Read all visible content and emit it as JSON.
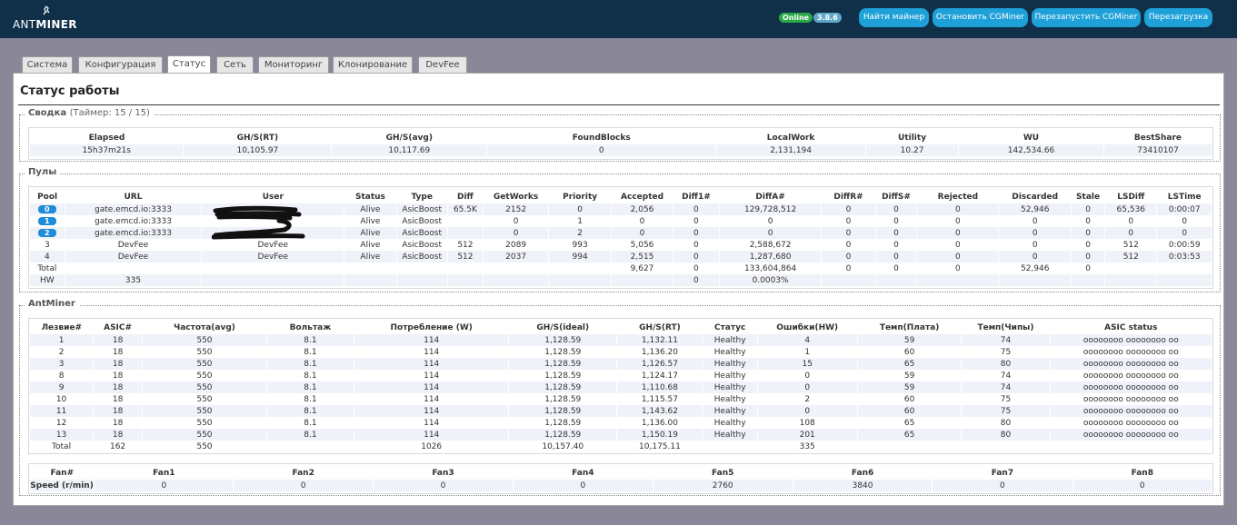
{
  "header": {
    "logo_prefix": "ANT",
    "logo_suffix": "MINER",
    "status_badge": "Online",
    "version_badge": "3.8.6",
    "buttons": [
      "Найти майнер",
      "Остановить CGMiner",
      "Перезапустить CGMiner",
      "Перезагрузка"
    ]
  },
  "tabs": [
    {
      "label": "Система",
      "active": false
    },
    {
      "label": "Конфигурация",
      "active": false
    },
    {
      "label": "Статус",
      "active": true
    },
    {
      "label": "Сеть",
      "active": false
    },
    {
      "label": "Мониторинг",
      "active": false
    },
    {
      "label": "Клонирование",
      "active": false
    },
    {
      "label": "DevFee",
      "active": false
    }
  ],
  "page_title": "Статус работы",
  "summary": {
    "legend": "Сводка",
    "timer": "(Таймер: 15 / 15)",
    "headers": [
      "Elapsed",
      "GH/S(RT)",
      "GH/S(avg)",
      "FoundBlocks",
      "LocalWork",
      "Utility",
      "WU",
      "BestShare"
    ],
    "values": [
      "15h37m21s",
      "10,105.97",
      "10,117.69",
      "0",
      "2,131,194",
      "10.27",
      "142,534.66",
      "73410107"
    ]
  },
  "pools": {
    "legend": "Пулы",
    "headers": [
      "Pool",
      "URL",
      "User",
      "Status",
      "Type",
      "Diff",
      "GetWorks",
      "Priority",
      "Accepted",
      "Diff1#",
      "DiffA#",
      "DiffR#",
      "DiffS#",
      "Rejected",
      "Discarded",
      "Stale",
      "LSDiff",
      "LSTime"
    ],
    "rows": [
      [
        "0",
        "gate.emcd.io:3333",
        "",
        "Alive",
        "AsicBoost",
        "65.5K",
        "2152",
        "0",
        "2,056",
        "0",
        "129,728,512",
        "0",
        "0",
        "0",
        "52,946",
        "0",
        "65,536",
        "0:00:07"
      ],
      [
        "1",
        "gate.emcd.io:3333",
        "",
        "Alive",
        "AsicBoost",
        "",
        "0",
        "1",
        "0",
        "0",
        "0",
        "0",
        "0",
        "0",
        "0",
        "0",
        "0",
        "0"
      ],
      [
        "2",
        "gate.emcd.io:3333",
        "",
        "Alive",
        "AsicBoost",
        "",
        "0",
        "2",
        "0",
        "0",
        "0",
        "0",
        "0",
        "0",
        "0",
        "0",
        "0",
        "0"
      ],
      [
        "3",
        "DevFee",
        "DevFee",
        "Alive",
        "AsicBoost",
        "512",
        "2089",
        "993",
        "5,056",
        "0",
        "2,588,672",
        "0",
        "0",
        "0",
        "0",
        "0",
        "512",
        "0:00:59"
      ],
      [
        "4",
        "DevFee",
        "DevFee",
        "Alive",
        "AsicBoost",
        "512",
        "2037",
        "994",
        "2,515",
        "0",
        "1,287,680",
        "0",
        "0",
        "0",
        "0",
        "0",
        "512",
        "0:03:53"
      ],
      [
        "Total",
        "",
        "",
        "",
        "",
        "",
        "",
        "",
        "9,627",
        "0",
        "133,604,864",
        "0",
        "0",
        "0",
        "52,946",
        "0",
        "",
        ""
      ],
      [
        "HW",
        "335",
        "",
        "",
        "",
        "",
        "",
        "",
        "",
        "0",
        "0.0003%",
        "",
        "",
        "",
        "",
        "",
        "",
        ""
      ]
    ]
  },
  "antminer": {
    "legend": "AntMiner",
    "headers": [
      "Лезвие#",
      "ASIC#",
      "Частота(avg)",
      "Вольтаж",
      "Потребление (W)",
      "GH/S(ideal)",
      "GH/S(RT)",
      "Статус",
      "Ошибки(HW)",
      "Темп(Плата)",
      "Темп(Чипы)",
      "ASIC status"
    ],
    "rows": [
      [
        "1",
        "18",
        "550",
        "8.1",
        "114",
        "1,128.59",
        "1,132.11",
        "Healthy",
        "4",
        "59",
        "74",
        "oooooooo oooooooo oo"
      ],
      [
        "2",
        "18",
        "550",
        "8.1",
        "114",
        "1,128.59",
        "1,136.20",
        "Healthy",
        "1",
        "60",
        "75",
        "oooooooo oooooooo oo"
      ],
      [
        "3",
        "18",
        "550",
        "8.1",
        "114",
        "1,128.59",
        "1,126.57",
        "Healthy",
        "15",
        "65",
        "80",
        "oooooooo oooooooo oo"
      ],
      [
        "8",
        "18",
        "550",
        "8.1",
        "114",
        "1,128.59",
        "1,124.17",
        "Healthy",
        "0",
        "59",
        "74",
        "oooooooo oooooooo oo"
      ],
      [
        "9",
        "18",
        "550",
        "8.1",
        "114",
        "1,128.59",
        "1,110.68",
        "Healthy",
        "0",
        "59",
        "74",
        "oooooooo oooooooo oo"
      ],
      [
        "10",
        "18",
        "550",
        "8.1",
        "114",
        "1,128.59",
        "1,115.57",
        "Healthy",
        "2",
        "60",
        "75",
        "oooooooo oooooooo oo"
      ],
      [
        "11",
        "18",
        "550",
        "8.1",
        "114",
        "1,128.59",
        "1,143.62",
        "Healthy",
        "0",
        "60",
        "75",
        "oooooooo oooooooo oo"
      ],
      [
        "12",
        "18",
        "550",
        "8.1",
        "114",
        "1,128.59",
        "1,136.00",
        "Healthy",
        "108",
        "65",
        "80",
        "oooooooo oooooooo oo"
      ],
      [
        "13",
        "18",
        "550",
        "8.1",
        "114",
        "1,128.59",
        "1,150.19",
        "Healthy",
        "201",
        "65",
        "80",
        "oooooooo oooooooo oo"
      ],
      [
        "Total",
        "162",
        "550",
        "",
        "1026",
        "10,157.40",
        "10,175.11",
        "",
        "335",
        "",
        "",
        ""
      ]
    ]
  },
  "fans": {
    "headers": [
      "Fan#",
      "Fan1",
      "Fan2",
      "Fan3",
      "Fan4",
      "Fan5",
      "Fan6",
      "Fan7",
      "Fan8"
    ],
    "values": [
      "Speed (r/min)",
      "0",
      "0",
      "0",
      "0",
      "2760",
      "3840",
      "0",
      "0"
    ]
  }
}
